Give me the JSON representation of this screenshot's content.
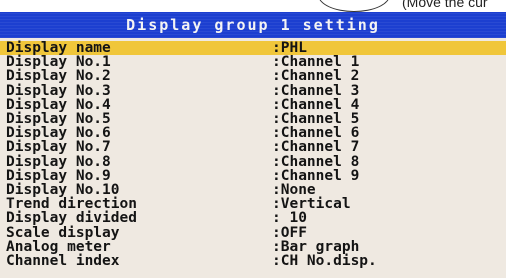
{
  "top_note": "(Move the cur",
  "title": "Display group 1 setting",
  "rows": [
    {
      "label": "Display name",
      "value": ":PHL",
      "selected": true
    },
    {
      "label": "Display No.1",
      "value": ":Channel  1"
    },
    {
      "label": "Display No.2",
      "value": ":Channel  2"
    },
    {
      "label": "Display No.3",
      "value": ":Channel  3"
    },
    {
      "label": "Display No.4",
      "value": ":Channel  4"
    },
    {
      "label": "Display No.5",
      "value": ":Channel  5"
    },
    {
      "label": "Display No.6",
      "value": ":Channel  6"
    },
    {
      "label": "Display No.7",
      "value": ":Channel  7"
    },
    {
      "label": "Display No.8",
      "value": ":Channel  8"
    },
    {
      "label": "Display No.9",
      "value": ":Channel  9"
    },
    {
      "label": "Display No.10",
      "value": ":None"
    },
    {
      "label": "Trend direction",
      "value": ":Vertical"
    },
    {
      "label": "Display divided",
      "value": ":  10"
    },
    {
      "label": "Scale display",
      "value": ":OFF"
    },
    {
      "label": "Analog meter",
      "value": ":Bar graph"
    },
    {
      "label": "Channel index",
      "value": ":CH No.disp."
    }
  ],
  "colors": {
    "title_bar": "#1c3fd0",
    "highlight": "#f0c63a",
    "screen_bg": "#efe9e1"
  }
}
